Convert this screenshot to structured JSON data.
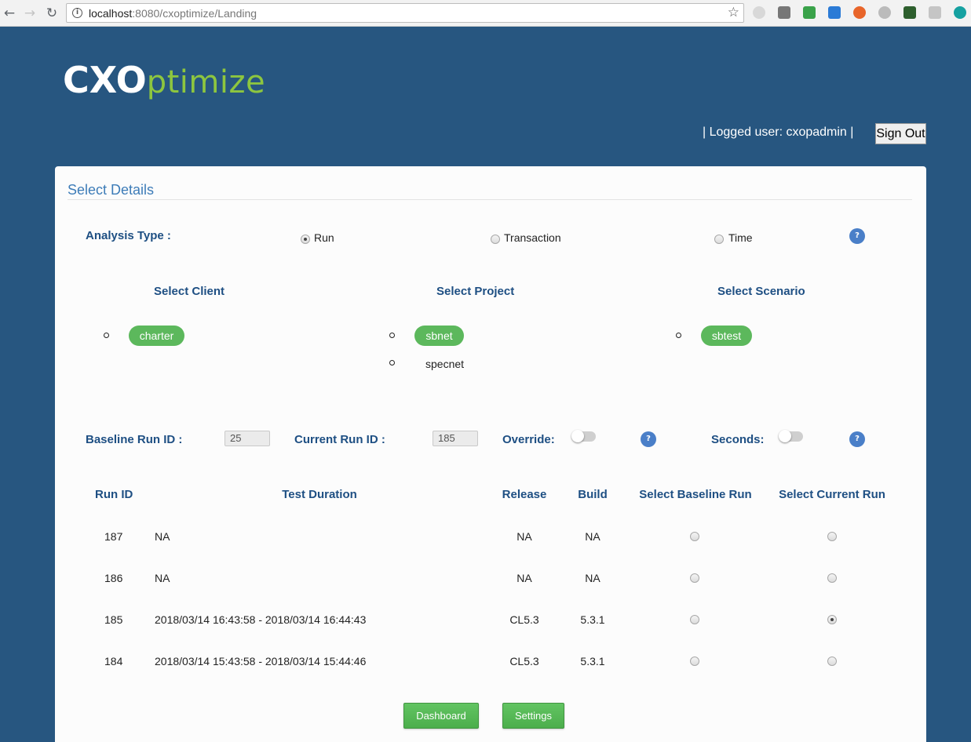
{
  "browser": {
    "url_host": "localhost",
    "url_rest": ":8080/cxoptimize/Landing"
  },
  "header": {
    "logo_cx": "CXO",
    "logo_optimize": "ptimize",
    "logged_user_text": "| Logged user: cxopadmin |",
    "sign_out_label": "Sign Out"
  },
  "panel": {
    "title": "Select Details"
  },
  "analysis": {
    "label": "Analysis Type :",
    "options": [
      {
        "label": "Run",
        "selected": true
      },
      {
        "label": "Transaction",
        "selected": false
      },
      {
        "label": "Time",
        "selected": false
      }
    ],
    "help": "?"
  },
  "selectors": {
    "client_label": "Select Client",
    "project_label": "Select Project",
    "scenario_label": "Select Scenario",
    "clients": [
      "charter"
    ],
    "projects": [
      "sbnet",
      "specnet"
    ],
    "scenarios": [
      "sbtest"
    ]
  },
  "run_ids": {
    "baseline_label": "Baseline Run ID :",
    "baseline_value": "25",
    "current_label": "Current Run ID :",
    "current_value": "185",
    "override_label": "Override:",
    "seconds_label": "Seconds:",
    "help": "?"
  },
  "table": {
    "headers": [
      "Run ID",
      "Test Duration",
      "Release",
      "Build",
      "Select Baseline Run",
      "Select Current Run"
    ],
    "rows": [
      {
        "run_id": "187",
        "duration": "NA",
        "release": "NA",
        "build": "NA",
        "baseline": false,
        "current": false
      },
      {
        "run_id": "186",
        "duration": "NA",
        "release": "NA",
        "build": "NA",
        "baseline": false,
        "current": false
      },
      {
        "run_id": "185",
        "duration": "2018/03/14 16:43:58 - 2018/03/14 16:44:43",
        "release": "CL5.3",
        "build": "5.3.1",
        "baseline": false,
        "current": true
      },
      {
        "run_id": "184",
        "duration": "2018/03/14 15:43:58 - 2018/03/14 15:44:46",
        "release": "CL5.3",
        "build": "5.3.1",
        "baseline": false,
        "current": false
      }
    ]
  },
  "buttons": {
    "dashboard": "Dashboard",
    "settings": "Settings"
  }
}
